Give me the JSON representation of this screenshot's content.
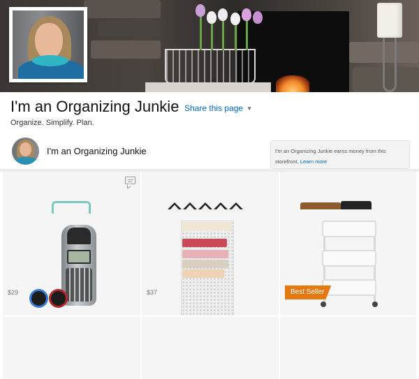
{
  "storefront": {
    "title": "I'm an Organizing Junkie",
    "share_label": "Share this page",
    "tagline": "Organize. Simplify. Plan.",
    "profile_name": "I'm an Organizing Junkie",
    "disclosure_text": "I'm an Organizing Junkie earns money from this storefront.",
    "learn_more": "Learn more"
  },
  "products": [
    {
      "price": "$29",
      "icon": "label-maker"
    },
    {
      "price": "$37",
      "icon": "wall-file-organizer"
    },
    {
      "badge": "Best Seller",
      "icon": "rolling-cart"
    }
  ],
  "colors": {
    "link": "#0066c0",
    "badge": "#e47911",
    "tile_bg": "#f5f5f5"
  },
  "icons": {
    "comment": "comment-icon",
    "share_chevron": "chevron-down-icon"
  }
}
